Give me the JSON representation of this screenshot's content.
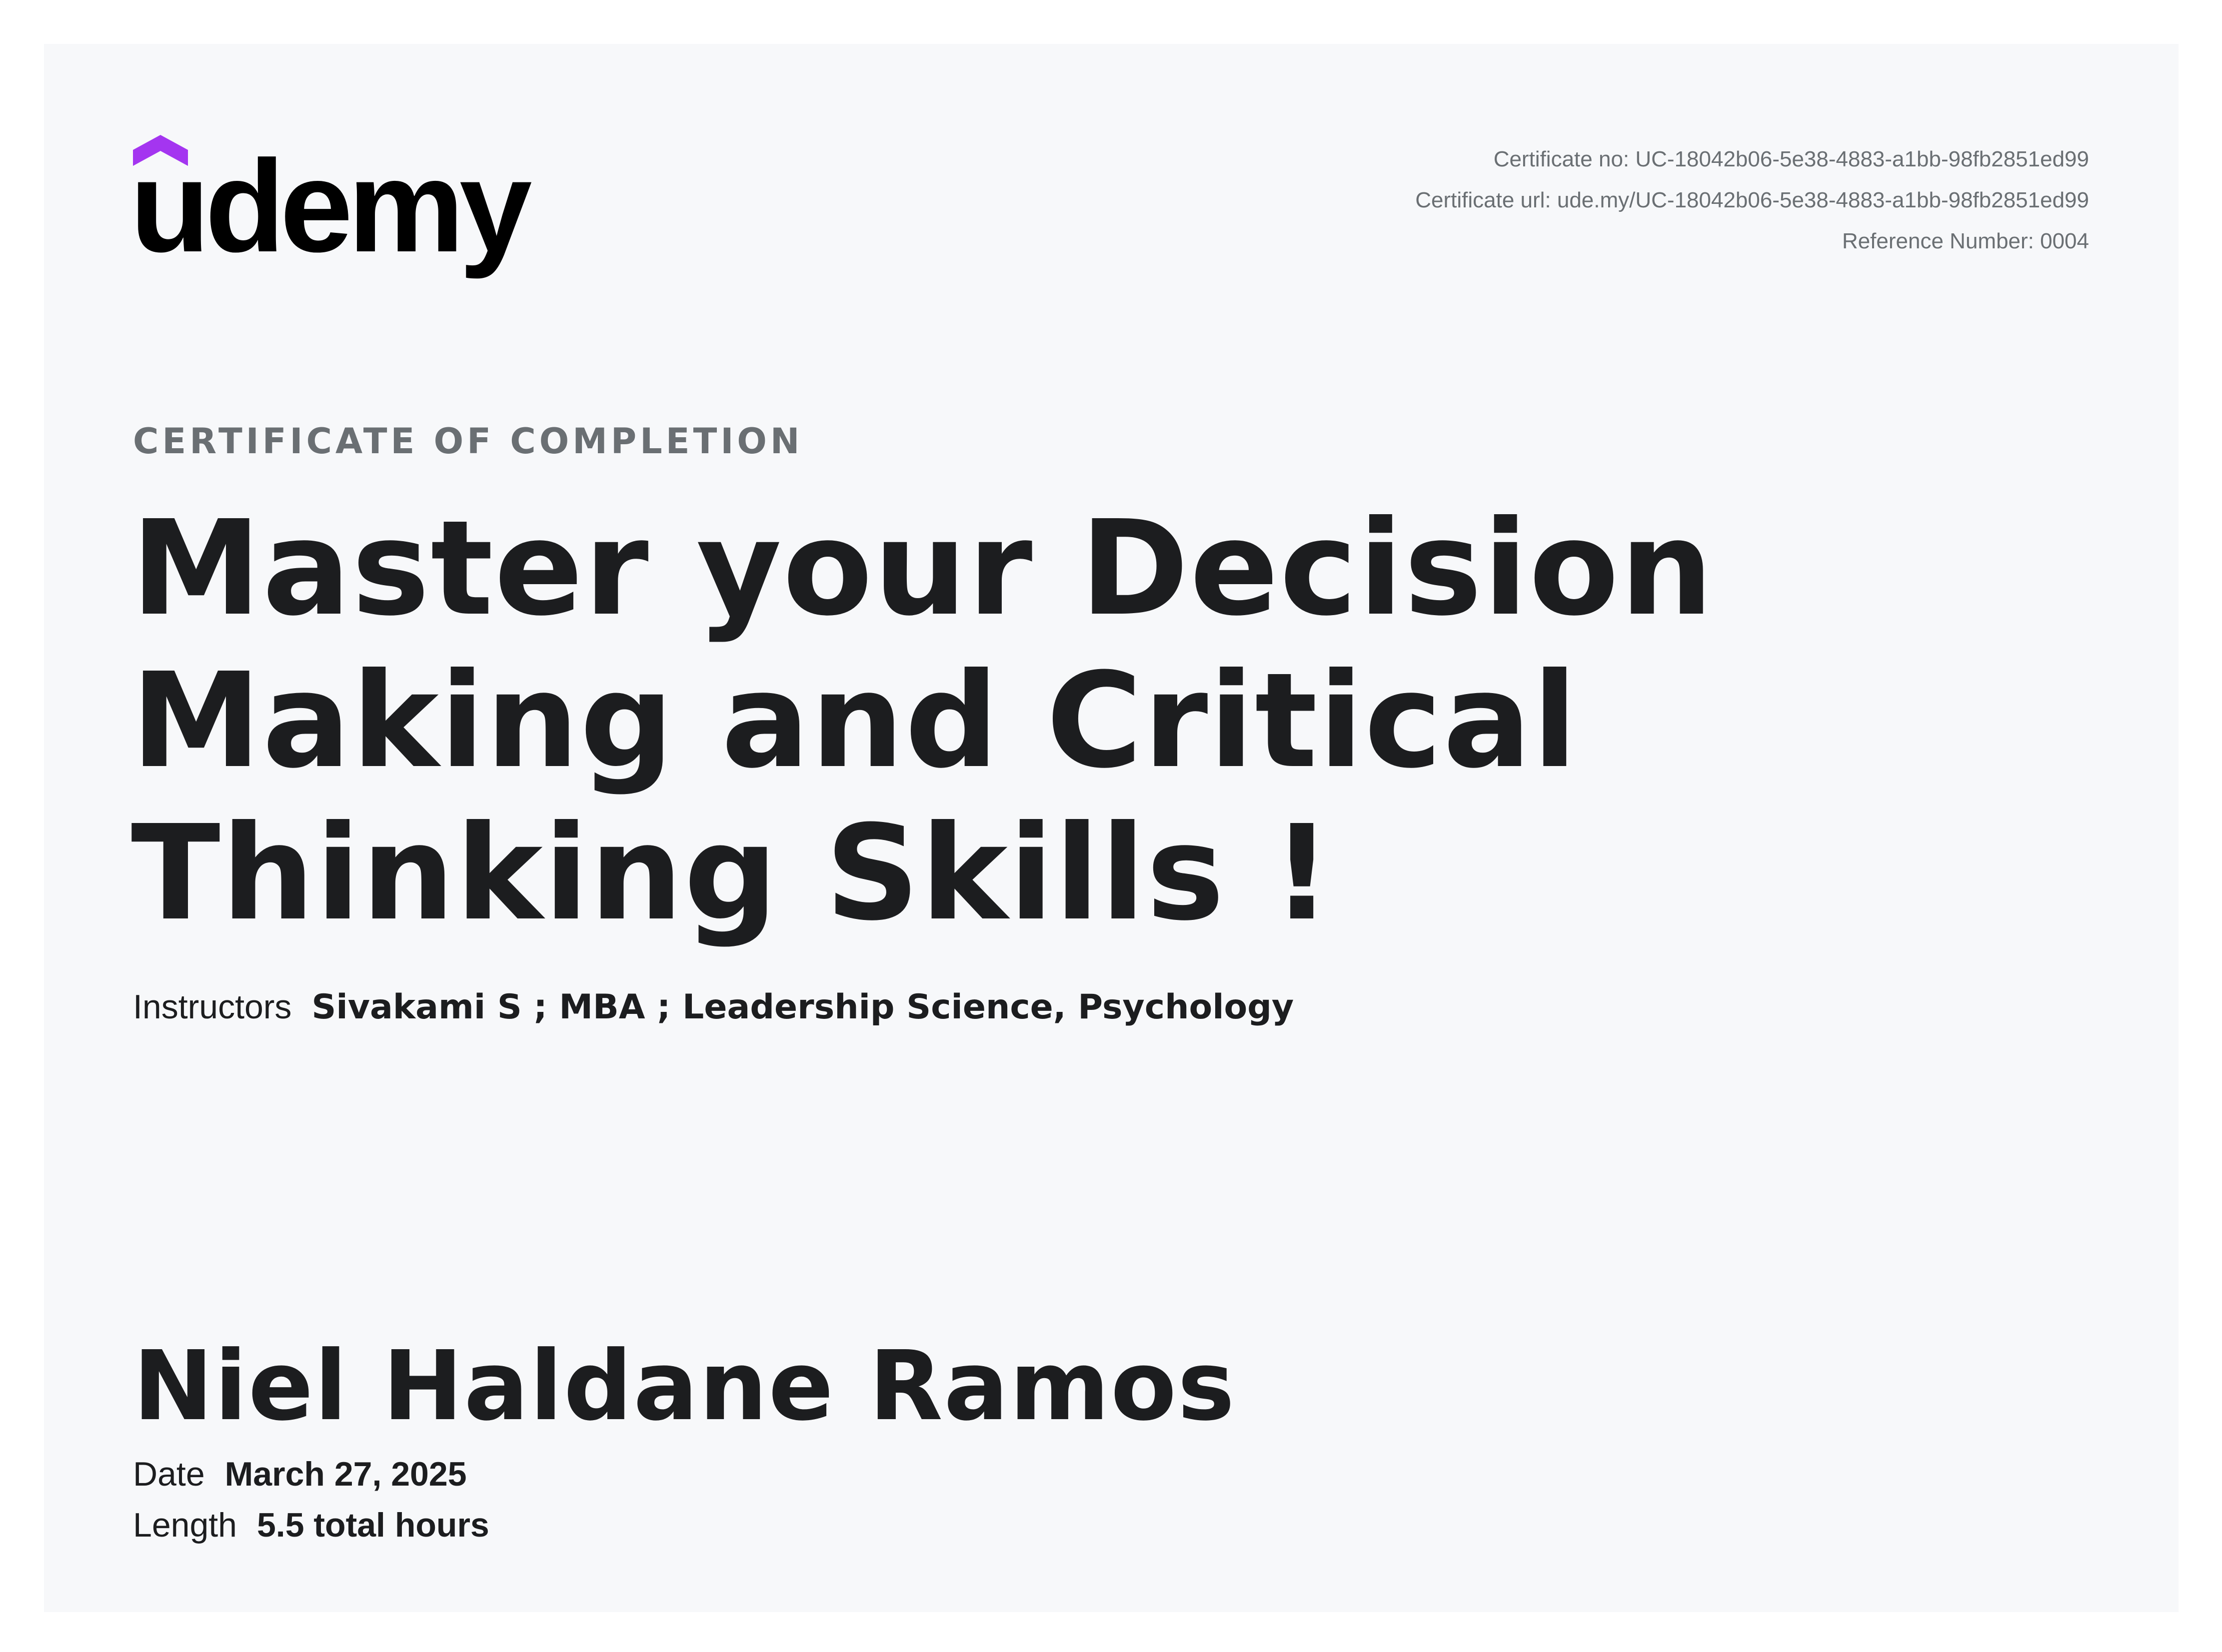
{
  "brand": {
    "logo_text": "udemy",
    "accent_color": "#a435f0"
  },
  "certificate": {
    "number_label": "Certificate no: UC-18042b06-5e38-4883-a1bb-98fb2851ed99",
    "url_label": "Certificate url: ude.my/UC-18042b06-5e38-4883-a1bb-98fb2851ed99",
    "reference_label": "Reference Number: 0004"
  },
  "heading": "CERTIFICATE OF COMPLETION",
  "course_title": "Master your Decision Making and Critical Thinking Skills !",
  "instructors": {
    "label": "Instructors",
    "value": "Sivakami S ; MBA ; Leadership Science, Psychology"
  },
  "recipient": "Niel Haldane Ramos",
  "date": {
    "label": "Date",
    "value": "March 27, 2025"
  },
  "length": {
    "label": "Length",
    "value": "5.5 total hours"
  }
}
